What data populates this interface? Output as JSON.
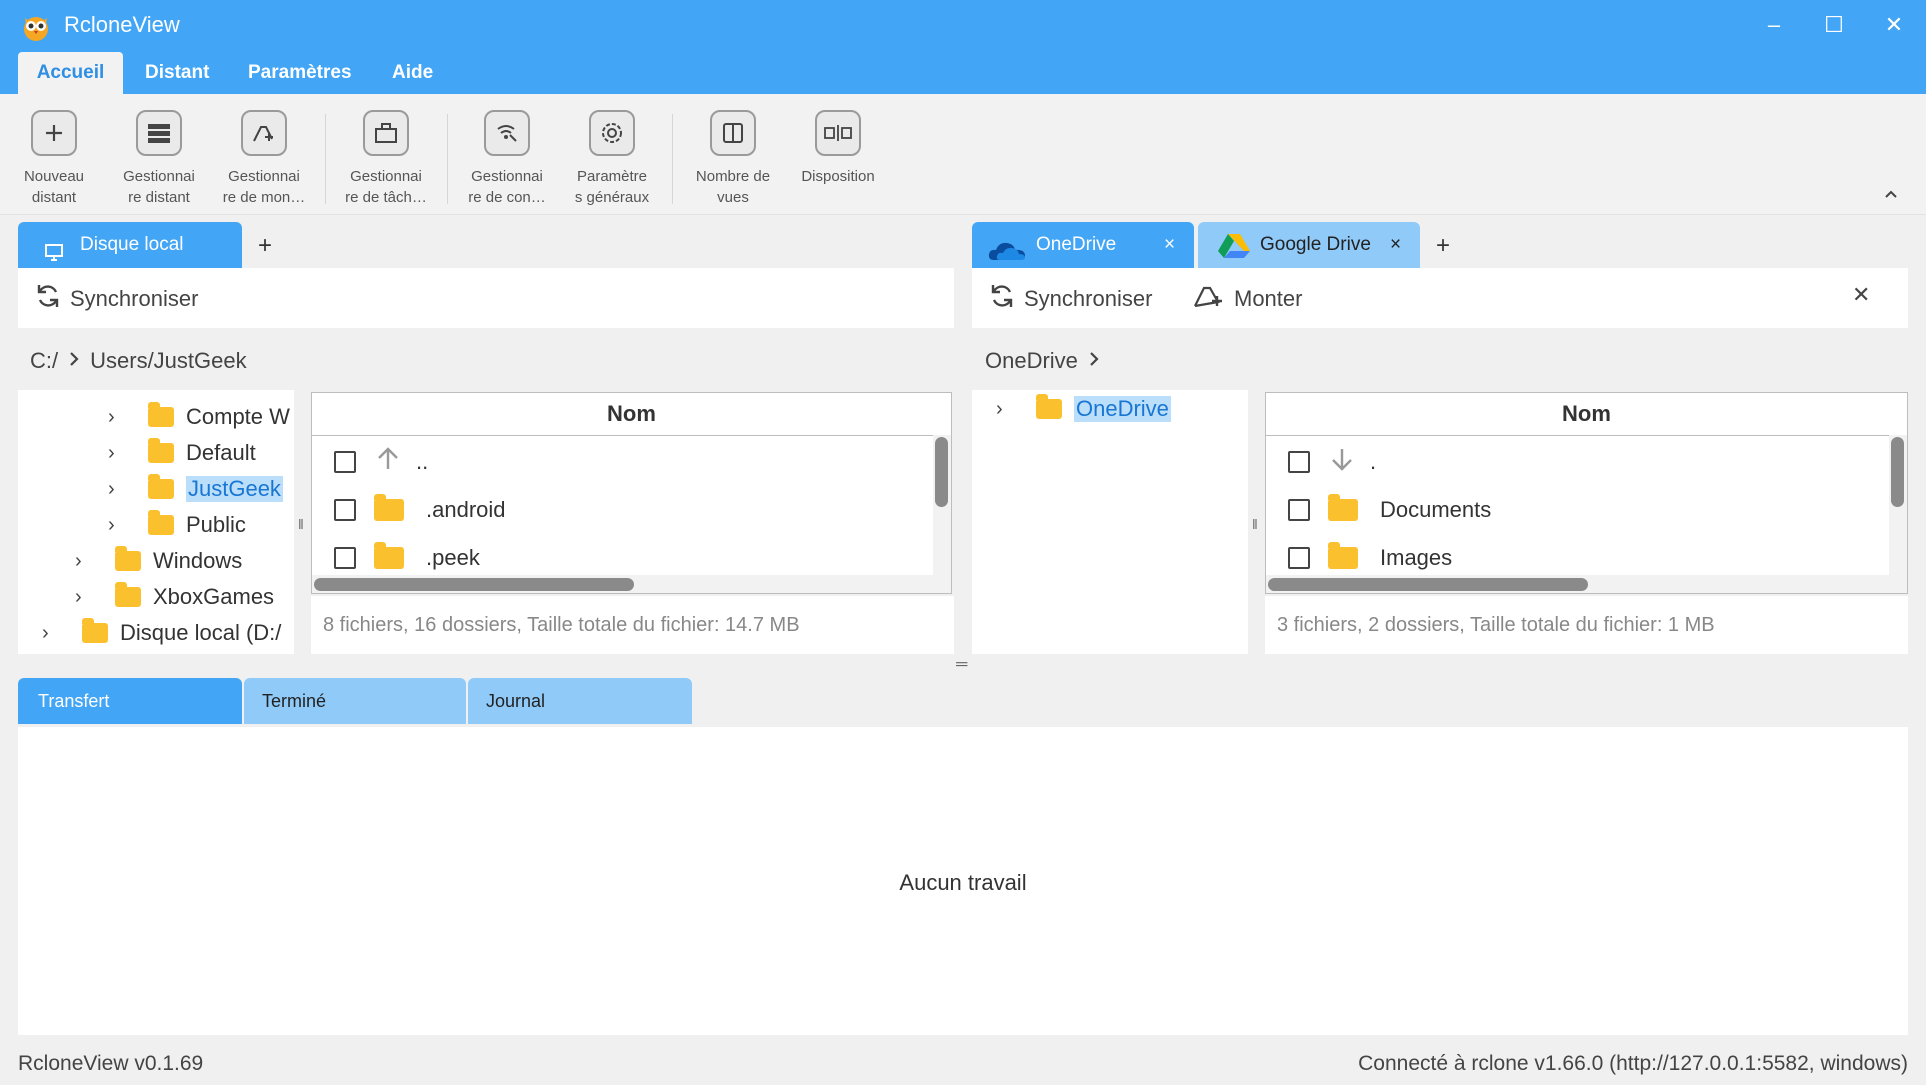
{
  "app": {
    "title": "RcloneView",
    "window_controls": {
      "minimize": "–",
      "maximize": "☐",
      "close": "✕"
    }
  },
  "menu": {
    "items": [
      "Accueil",
      "Distant",
      "Paramètres",
      "Aide"
    ],
    "active": "Accueil"
  },
  "ribbon": {
    "buttons": [
      {
        "name": "new-remote",
        "line1": "Nouveau",
        "line2": "distant",
        "icon": "plus-icon"
      },
      {
        "name": "remote-manager",
        "line1": "Gestionnai",
        "line2": "re distant",
        "icon": "server-list-icon"
      },
      {
        "name": "mount-manager",
        "line1": "Gestionnai",
        "line2": "re de mon…",
        "icon": "cloud-mount-icon"
      },
      {
        "name": "task-manager",
        "line1": "Gestionnai",
        "line2": "re de tâch…",
        "icon": "briefcase-icon"
      },
      {
        "name": "connection-manager",
        "line1": "Gestionnai",
        "line2": "re de con…",
        "icon": "signal-icon"
      },
      {
        "name": "general-settings",
        "line1": "Paramètre",
        "line2": "s généraux",
        "icon": "gear-icon"
      },
      {
        "name": "view-count",
        "line1": "Nombre de",
        "line2": "vues",
        "icon": "columns-icon"
      },
      {
        "name": "layout",
        "line1": "Disposition",
        "line2": "",
        "icon": "layout-split-icon"
      }
    ],
    "collapse": "^"
  },
  "left_panel": {
    "tabs": [
      {
        "label": "Disque local",
        "icon": "monitor-icon",
        "active": true
      }
    ],
    "add_tab": "+",
    "toolbar": {
      "sync": "Synchroniser"
    },
    "path": {
      "root": "C:/",
      "rest": "Users/JustGeek"
    },
    "tree": [
      {
        "label": "Compte W",
        "selected": false
      },
      {
        "label": "Default",
        "selected": false
      },
      {
        "label": "JustGeek",
        "selected": true
      },
      {
        "label": "Public",
        "selected": false
      },
      {
        "label": "Windows",
        "selected": false
      },
      {
        "label": "XboxGames",
        "selected": false
      },
      {
        "label": "Disque local (D:/",
        "selected": false
      }
    ],
    "file_header": "Nom",
    "files": [
      "..",
      ".android",
      ".peek"
    ],
    "status": "8 fichiers, 16 dossiers, Taille totale du fichier: 14.7 MB"
  },
  "right_panel": {
    "tabs": [
      {
        "label": "OneDrive",
        "close": "×",
        "active": true
      },
      {
        "label": "Google Drive",
        "close": "×",
        "active": false
      }
    ],
    "add_tab": "+",
    "toolbar": {
      "sync": "Synchroniser",
      "mount": "Monter",
      "close": "✕"
    },
    "path": {
      "root": "OneDrive"
    },
    "tree": [
      {
        "label": "OneDrive",
        "selected": true
      }
    ],
    "file_header": "Nom",
    "files": [
      ".",
      "Documents",
      "Images"
    ],
    "status": "3 fichiers, 2 dossiers, Taille totale du fichier: 1 MB"
  },
  "bottom": {
    "tabs": [
      "Transfert",
      "Terminé",
      "Journal"
    ],
    "active": "Transfert",
    "empty_message": "Aucun travail"
  },
  "statusbar": {
    "version": "RcloneView v0.1.69",
    "connection": "Connecté à rclone v1.66.0 (http://127.0.0.1:5582, windows)"
  },
  "colors": {
    "accent": "#42a5f5",
    "tab_inactive": "#90caf9",
    "folder": "#fbc02d",
    "selection": "#bbdefb"
  }
}
